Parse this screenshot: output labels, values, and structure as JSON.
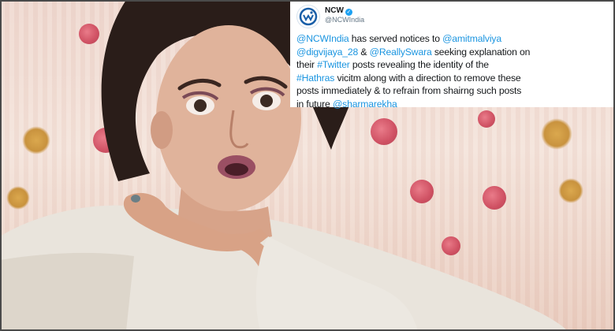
{
  "tweet": {
    "display_name": "NCW",
    "handle": "@NCWIndia",
    "verified_glyph": "✓",
    "lines": [
      [
        {
          "t": "@NCWIndia",
          "k": "mention"
        },
        {
          "t": " has served notices to ",
          "k": "text"
        },
        {
          "t": "@amitmalviya",
          "k": "mention"
        }
      ],
      [
        {
          "t": "@digvijaya_28",
          "k": "mention"
        },
        {
          "t": " & ",
          "k": "text"
        },
        {
          "t": "@ReallySwara",
          "k": "mention"
        },
        {
          "t": " seeking explanation on",
          "k": "text"
        }
      ],
      [
        {
          "t": "their ",
          "k": "text"
        },
        {
          "t": "#Twitter",
          "k": "hashtag"
        },
        {
          "t": " posts revealing the identity of the",
          "k": "text"
        }
      ],
      [
        {
          "t": "#Hathras",
          "k": "hashtag"
        },
        {
          "t": " vicitm along with a direction to remove these",
          "k": "text"
        }
      ],
      [
        {
          "t": "posts immediately & to refrain from shairng such posts",
          "k": "text"
        }
      ],
      [
        {
          "t": "in future ",
          "k": "text"
        },
        {
          "t": "@sharmarekha",
          "k": "mention"
        }
      ]
    ]
  },
  "colors": {
    "link": "#1b95e0",
    "text": "#14171a",
    "handle": "#657786",
    "verified": "#1da1f2",
    "logo": "#1a5fa8"
  },
  "icons": {
    "logo": "ncw-logo-icon",
    "verified": "verified-badge-icon"
  }
}
